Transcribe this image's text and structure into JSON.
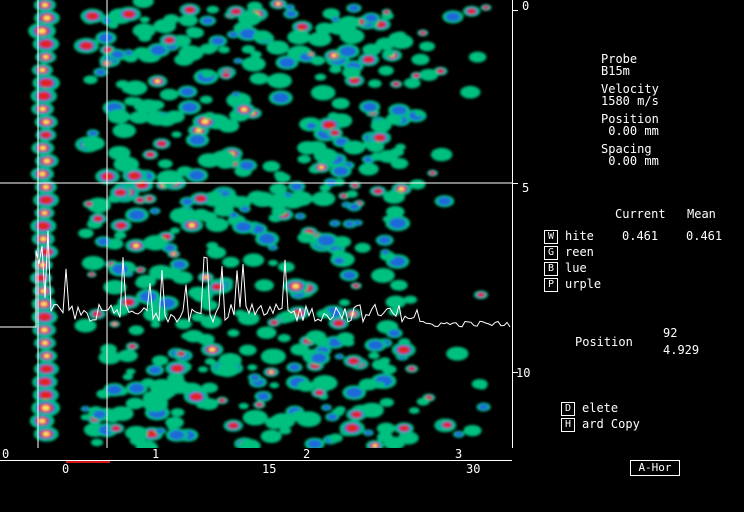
{
  "scale_right": {
    "labels": [
      "0",
      "5",
      "10"
    ]
  },
  "scale_bottom": {
    "top_labels": [
      "0",
      "1",
      "2",
      "3"
    ],
    "bottom_labels": [
      "0",
      "15",
      "30"
    ]
  },
  "info": {
    "probe_label": "Probe",
    "probe_value": "B15m",
    "velocity_label": "Velocity",
    "velocity_value": "1580 m/s",
    "position_label": "Position",
    "position_value": " 0.00 mm",
    "spacing_label": "Spacing",
    "spacing_value": " 0.00 mm"
  },
  "channels": {
    "col_current": "Current",
    "col_mean": "Mean",
    "rows": [
      {
        "key": "W",
        "rest": "hite",
        "current": "0.461",
        "mean": "0.461"
      },
      {
        "key": "G",
        "rest": "reen"
      },
      {
        "key": "B",
        "rest": "lue"
      },
      {
        "key": "P",
        "rest": "urple"
      }
    ]
  },
  "position": {
    "label": "Position",
    "value1": "92",
    "value2": "4.929"
  },
  "actions": [
    {
      "key": "D",
      "rest": "elete"
    },
    {
      "key": "H",
      "rest": "ard Copy"
    }
  ],
  "mode_button": "A-Hor",
  "colors": {
    "low": "#00c080",
    "mid": "#1a6ad8",
    "high": "#e02020",
    "peak": "#ffe070"
  }
}
